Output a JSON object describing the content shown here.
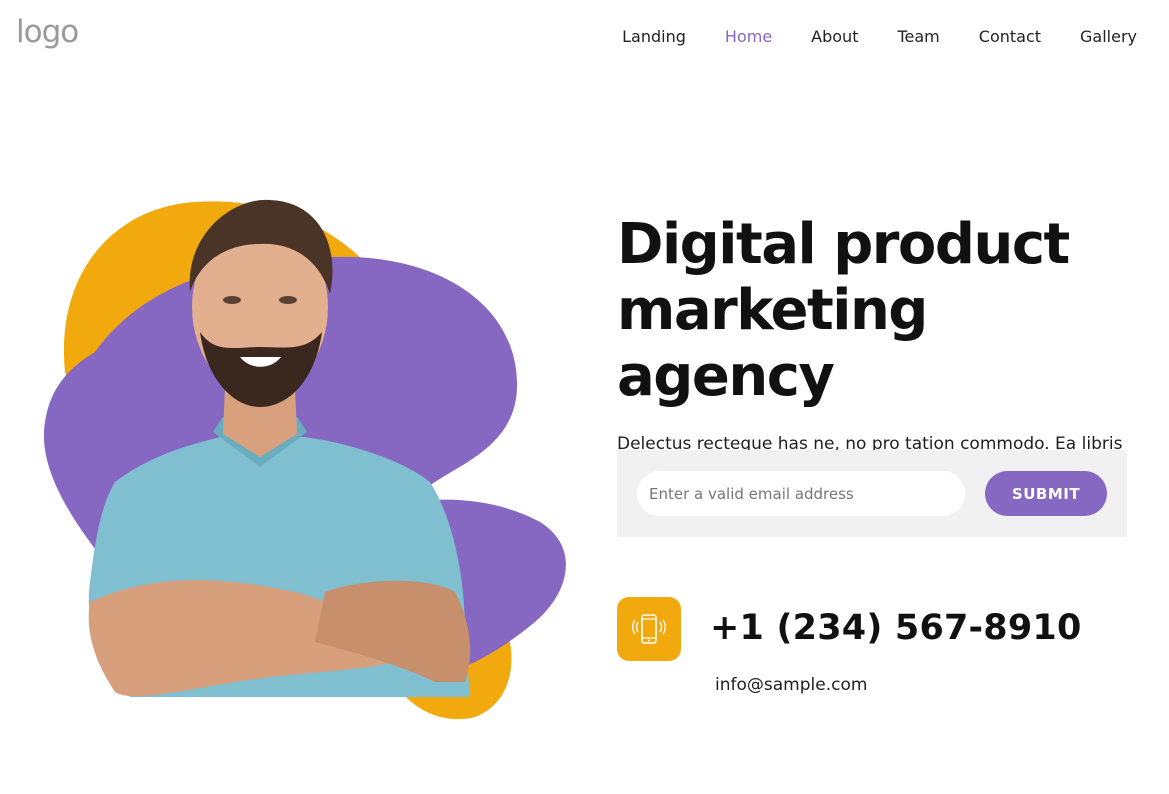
{
  "header": {
    "logo_text": "logo",
    "nav": [
      {
        "label": "Landing",
        "active": false
      },
      {
        "label": "Home",
        "active": true
      },
      {
        "label": "About",
        "active": false
      },
      {
        "label": "Team",
        "active": false
      },
      {
        "label": "Contact",
        "active": false
      },
      {
        "label": "Gallery",
        "active": false
      }
    ]
  },
  "hero": {
    "headline_line1": "Digital product",
    "headline_line2": "marketing agency",
    "description": "Delectus recteque has ne, no pro tation commodo. Ea libris utamur vix, in sumo augue soluta vis.",
    "image_icon": "smiling-man-portrait"
  },
  "subscribe": {
    "email_placeholder": "Enter a valid email address",
    "email_value": "",
    "submit_label": "SUBMIT"
  },
  "contact": {
    "phone_icon": "smartphone-icon",
    "phone": "+1 (234) 567-8910",
    "email": "info@sample.com"
  },
  "colors": {
    "accent_purple": "#8668c3",
    "accent_orange": "#f2a90e",
    "panel_gray": "#f1f1f1",
    "logo_gray": "#9a9a9a"
  }
}
